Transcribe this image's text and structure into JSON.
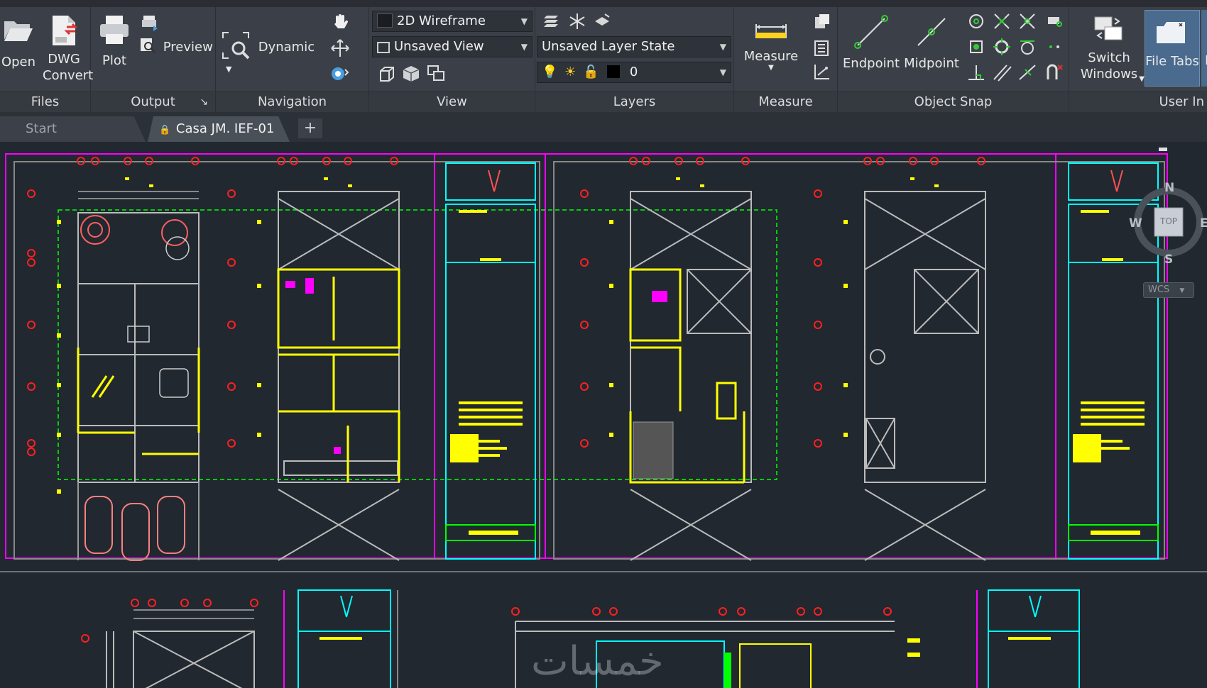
{
  "ribbon": {
    "files": {
      "title": "Files",
      "open": "Open",
      "dwg_convert_1": "DWG",
      "dwg_convert_2": "Convert"
    },
    "output": {
      "title": "Output",
      "plot": "Plot",
      "preview": "Preview",
      "launcher": "↘"
    },
    "navigation": {
      "title": "Navigation",
      "dynamic": "Dynamic"
    },
    "view": {
      "title": "View",
      "visual_style": "2D Wireframe",
      "named_view": "Unsaved View"
    },
    "layers": {
      "title": "Layers",
      "layer_state": "Unsaved Layer State",
      "current_layer": "0"
    },
    "measure": {
      "title": "Measure",
      "measure": "Measure"
    },
    "object_snap": {
      "title": "Object Snap",
      "endpoint": "Endpoint",
      "midpoint": "Midpoint"
    },
    "user_interface": {
      "title": "User In",
      "switch_windows_1": "Switch",
      "switch_windows_2": "Windows",
      "file_tabs": "File Tabs",
      "layout_partial": "L"
    }
  },
  "tabs": [
    {
      "label": "Start"
    },
    {
      "label": "Casa JM. IEF-01",
      "close": "✕"
    }
  ],
  "new_tab": "+",
  "viewcube": {
    "north": "N",
    "south": "S",
    "west": "W",
    "east": "E",
    "face": "TOP",
    "ucs": "WCS"
  },
  "watermark": "خمسات",
  "colors": {
    "ribbon": "#3b4048",
    "canvas": "#212830",
    "highlight": "#4a6a8e",
    "cad_yellow": "#ffff00",
    "cad_magenta": "#ff00ff",
    "cad_cyan": "#00ffff",
    "cad_red": "#ff0000",
    "cad_green": "#00ff00"
  }
}
